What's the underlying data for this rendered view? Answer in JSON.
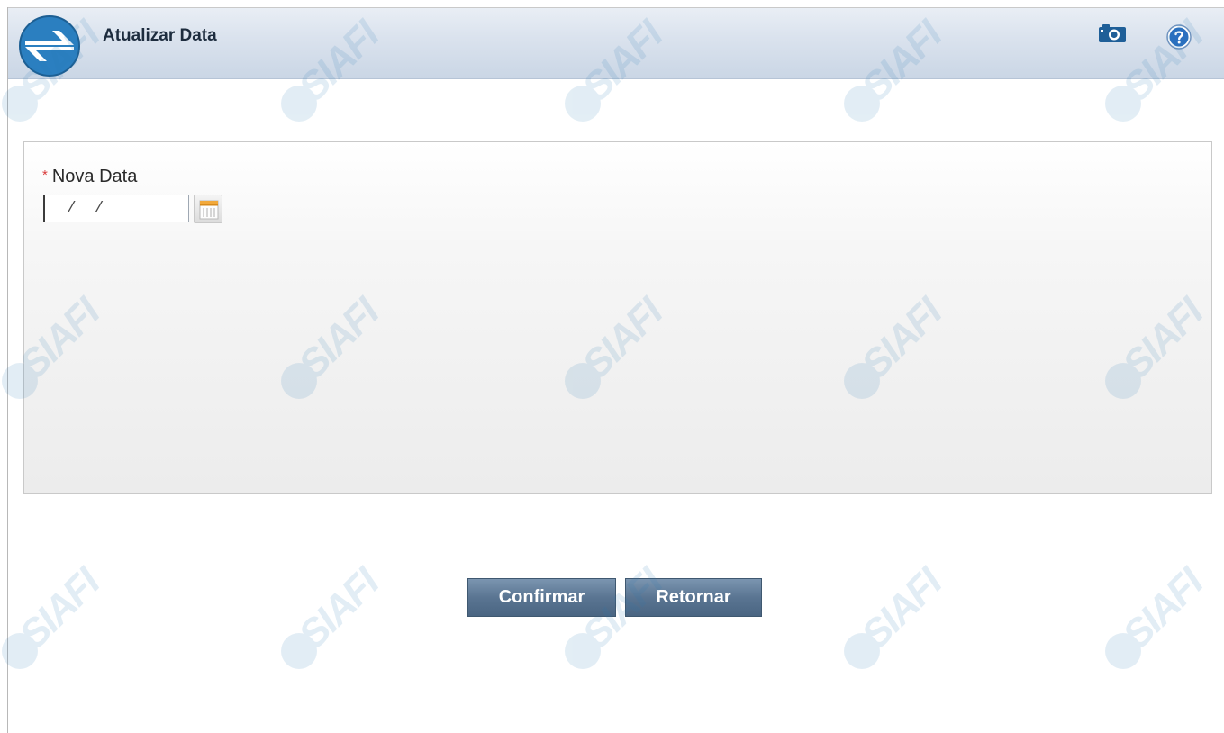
{
  "header": {
    "title": "Atualizar Data",
    "logo_icon": "sinfo-logo-icon",
    "camera_icon": "camera-icon",
    "help_icon": "help-icon"
  },
  "form": {
    "required_mark": "*",
    "date_label": "Nova Data",
    "date_value": "__/__/____",
    "calendar_icon": "calendar-icon"
  },
  "actions": {
    "confirm_label": "Confirmar",
    "return_label": "Retornar"
  },
  "watermark": {
    "text": "SIAFI"
  },
  "colors": {
    "accent": "#5a7592",
    "logo_blue": "#2a7ab5",
    "required": "#d93a3a"
  }
}
